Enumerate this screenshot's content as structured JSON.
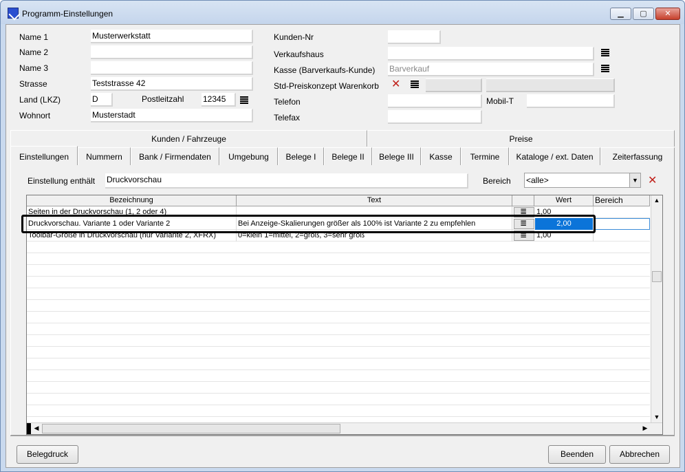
{
  "window": {
    "title": "Programm-Einstellungen"
  },
  "customer": {
    "name1_label": "Name 1",
    "name1_value": "Musterwerkstatt",
    "name2_label": "Name 2",
    "name2_value": "",
    "name3_label": "Name 3",
    "name3_value": "",
    "street_label": "Strasse",
    "street_value": "Teststrasse 42",
    "country_label": "Land (LKZ)",
    "country_value": "D",
    "zip_label": "Postleitzahl",
    "zip_value": "12345",
    "city_label": "Wohnort",
    "city_value": "Musterstadt",
    "kundennr_label": "Kunden-Nr",
    "kundennr_value": "",
    "verkaufshaus_label": "Verkaufshaus",
    "verkaufshaus_value": "",
    "kasse_label": "Kasse (Barverkaufs-Kunde)",
    "kasse_value": "Barverkauf",
    "preiskonzept_label": "Std-Preiskonzept Warenkorb",
    "telefon_label": "Telefon",
    "telefon_value": "",
    "mobil_label": "Mobil-T",
    "mobil_value": "",
    "telefax_label": "Telefax",
    "telefax_value": ""
  },
  "upper_tabs": [
    "Kunden / Fahrzeuge",
    "Preise"
  ],
  "tabs": [
    "Einstellungen",
    "Nummern",
    "Bank / Firmendaten",
    "Umgebung",
    "Belege I",
    "Belege II",
    "Belege III",
    "Kasse",
    "Termine",
    "Kataloge / ext. Daten",
    "Zeiterfassung"
  ],
  "filter": {
    "label": "Einstellung enthält",
    "value": "Druckvorschau",
    "bereich_label": "Bereich",
    "bereich_value": "<alle>"
  },
  "grid": {
    "headers": [
      "Bezeichnung",
      "Text",
      "",
      "Wert",
      "Bereich"
    ],
    "rows": [
      {
        "bezeichnung": "Seiten in der Druckvorschau (1, 2 oder 4)",
        "text": "",
        "wert": "1,00"
      },
      {
        "bezeichnung": "Druckvorschau. Variante 1 oder Variante 2",
        "text": "Bei Anzeige-Skalierungen größer als 100% ist Variante 2 zu empfehlen",
        "wert": "2,00"
      },
      {
        "bezeichnung": "Toolbar-Größe in Druckvorschau (nur Variante 2, XFRX)",
        "text": "0=klein 1=mittel, 2=groß, 3=sehr groß",
        "wert": "1,00"
      }
    ]
  },
  "buttons": {
    "belegdruck": "Belegdruck",
    "beenden": "Beenden",
    "abbrechen": "Abbrechen"
  }
}
